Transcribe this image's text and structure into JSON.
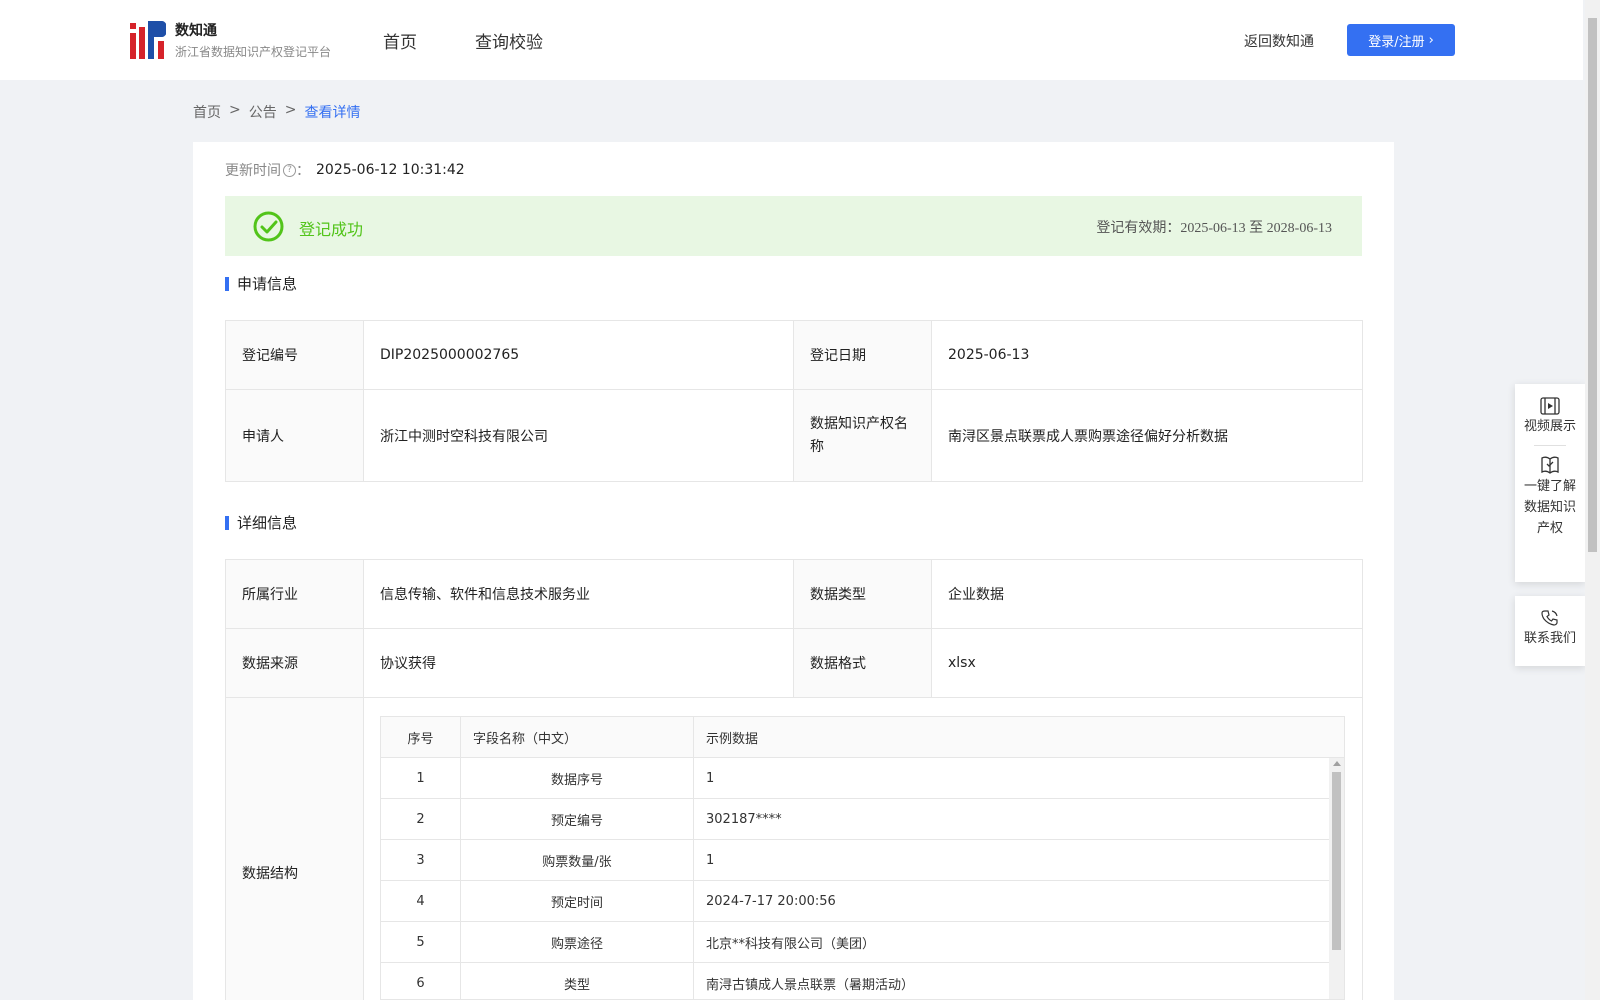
{
  "header": {
    "brand_name": "数知通",
    "brand_sub": "浙江省数据知识产权登记平台",
    "nav": [
      "首页",
      "查询校验"
    ],
    "back_link": "返回数知通",
    "login_button": "登录/注册"
  },
  "breadcrumb": {
    "home": "首页",
    "section": "公告",
    "current": "查看详情",
    "separator": ">"
  },
  "detail": {
    "update_label": "更新时间",
    "update_colon": "：",
    "update_value": "2025-06-12 10:31:42",
    "status": "登记成功",
    "validity_label": "登记有效期：",
    "validity_dates": "2025-06-13 至 2028-06-13"
  },
  "application": {
    "section_title": "申请信息",
    "reg_no_label": "登记编号",
    "reg_no_value": "DIP2025000002765",
    "reg_date_label": "登记日期",
    "reg_date_value": "2025-06-13",
    "applicant_label": "申请人",
    "applicant_value": "浙江中测时空科技有限公司",
    "ip_name_label": "数据知识产权名称",
    "ip_name_value": "南浔区景点联票成人票购票途径偏好分析数据"
  },
  "details": {
    "section_title": "详细信息",
    "industry_label": "所属行业",
    "industry_value": "信息传输、软件和信息技术服务业",
    "data_type_label": "数据类型",
    "data_type_value": "企业数据",
    "source_label": "数据来源",
    "source_value": "协议获得",
    "format_label": "数据格式",
    "format_value": "xlsx",
    "structure_label": "数据结构"
  },
  "structure_table": {
    "headers": [
      "序号",
      "字段名称（中文）",
      "示例数据"
    ],
    "rows": [
      [
        "1",
        "数据序号",
        "1"
      ],
      [
        "2",
        "预定编号",
        "302187****"
      ],
      [
        "3",
        "购票数量/张",
        "1"
      ],
      [
        "4",
        "预定时间",
        "2024-7-17 20:00:56"
      ],
      [
        "5",
        "购票途径",
        "北京**科技有限公司（美团）"
      ],
      [
        "6",
        "类型",
        "南浔古镇成人景点联票（暑期活动）"
      ]
    ]
  },
  "side_panel": {
    "video": "视频展示",
    "learn_line1": "一键了解",
    "learn_line2": "数据知识",
    "learn_line3": "产权",
    "contact": "联系我们"
  },
  "colors": {
    "accent": "#3470f2",
    "success": "#52c41a",
    "success_bg": "#e8f7e3"
  }
}
